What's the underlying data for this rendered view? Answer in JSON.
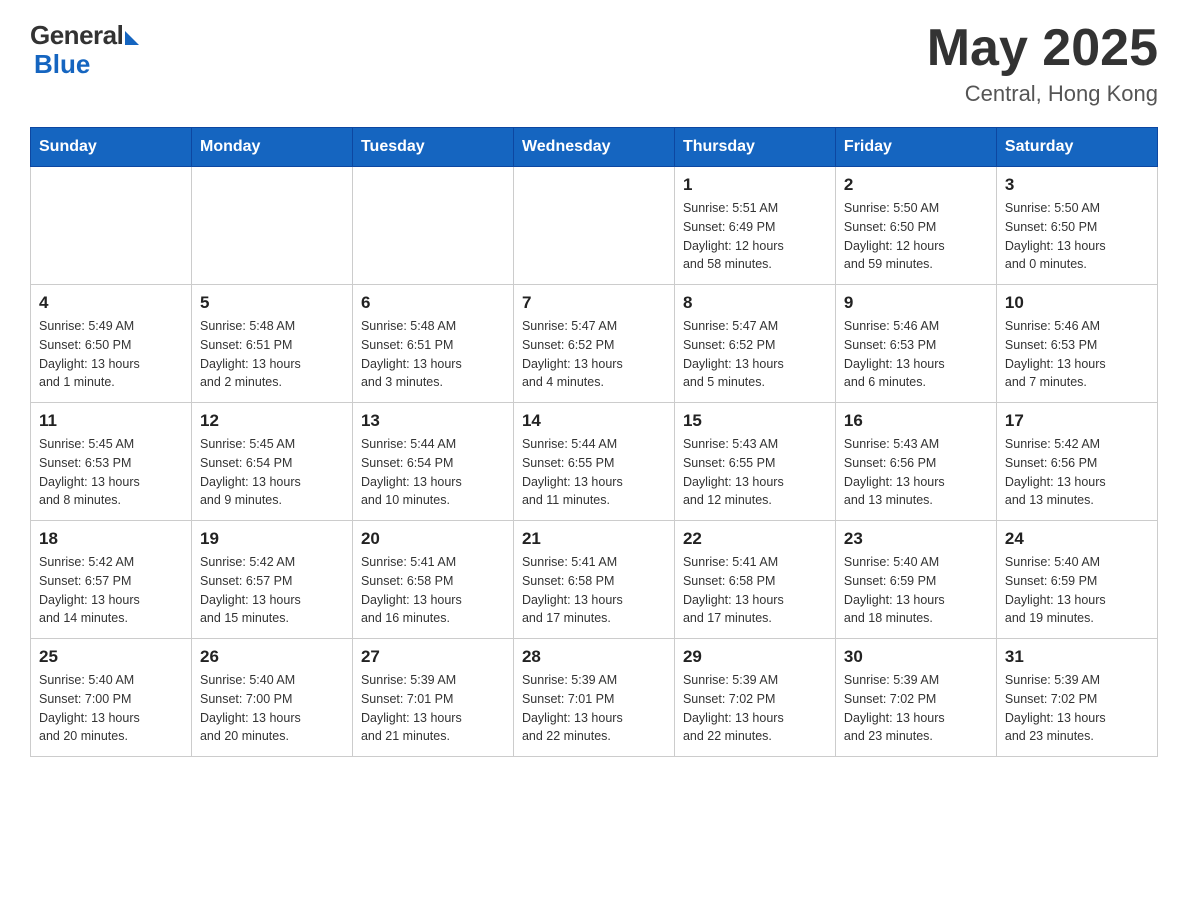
{
  "header": {
    "logo": {
      "general": "General",
      "blue": "Blue"
    },
    "month_year": "May 2025",
    "location": "Central, Hong Kong"
  },
  "days_of_week": [
    "Sunday",
    "Monday",
    "Tuesday",
    "Wednesday",
    "Thursday",
    "Friday",
    "Saturday"
  ],
  "weeks": [
    [
      {
        "day": "",
        "info": ""
      },
      {
        "day": "",
        "info": ""
      },
      {
        "day": "",
        "info": ""
      },
      {
        "day": "",
        "info": ""
      },
      {
        "day": "1",
        "info": "Sunrise: 5:51 AM\nSunset: 6:49 PM\nDaylight: 12 hours\nand 58 minutes."
      },
      {
        "day": "2",
        "info": "Sunrise: 5:50 AM\nSunset: 6:50 PM\nDaylight: 12 hours\nand 59 minutes."
      },
      {
        "day": "3",
        "info": "Sunrise: 5:50 AM\nSunset: 6:50 PM\nDaylight: 13 hours\nand 0 minutes."
      }
    ],
    [
      {
        "day": "4",
        "info": "Sunrise: 5:49 AM\nSunset: 6:50 PM\nDaylight: 13 hours\nand 1 minute."
      },
      {
        "day": "5",
        "info": "Sunrise: 5:48 AM\nSunset: 6:51 PM\nDaylight: 13 hours\nand 2 minutes."
      },
      {
        "day": "6",
        "info": "Sunrise: 5:48 AM\nSunset: 6:51 PM\nDaylight: 13 hours\nand 3 minutes."
      },
      {
        "day": "7",
        "info": "Sunrise: 5:47 AM\nSunset: 6:52 PM\nDaylight: 13 hours\nand 4 minutes."
      },
      {
        "day": "8",
        "info": "Sunrise: 5:47 AM\nSunset: 6:52 PM\nDaylight: 13 hours\nand 5 minutes."
      },
      {
        "day": "9",
        "info": "Sunrise: 5:46 AM\nSunset: 6:53 PM\nDaylight: 13 hours\nand 6 minutes."
      },
      {
        "day": "10",
        "info": "Sunrise: 5:46 AM\nSunset: 6:53 PM\nDaylight: 13 hours\nand 7 minutes."
      }
    ],
    [
      {
        "day": "11",
        "info": "Sunrise: 5:45 AM\nSunset: 6:53 PM\nDaylight: 13 hours\nand 8 minutes."
      },
      {
        "day": "12",
        "info": "Sunrise: 5:45 AM\nSunset: 6:54 PM\nDaylight: 13 hours\nand 9 minutes."
      },
      {
        "day": "13",
        "info": "Sunrise: 5:44 AM\nSunset: 6:54 PM\nDaylight: 13 hours\nand 10 minutes."
      },
      {
        "day": "14",
        "info": "Sunrise: 5:44 AM\nSunset: 6:55 PM\nDaylight: 13 hours\nand 11 minutes."
      },
      {
        "day": "15",
        "info": "Sunrise: 5:43 AM\nSunset: 6:55 PM\nDaylight: 13 hours\nand 12 minutes."
      },
      {
        "day": "16",
        "info": "Sunrise: 5:43 AM\nSunset: 6:56 PM\nDaylight: 13 hours\nand 13 minutes."
      },
      {
        "day": "17",
        "info": "Sunrise: 5:42 AM\nSunset: 6:56 PM\nDaylight: 13 hours\nand 13 minutes."
      }
    ],
    [
      {
        "day": "18",
        "info": "Sunrise: 5:42 AM\nSunset: 6:57 PM\nDaylight: 13 hours\nand 14 minutes."
      },
      {
        "day": "19",
        "info": "Sunrise: 5:42 AM\nSunset: 6:57 PM\nDaylight: 13 hours\nand 15 minutes."
      },
      {
        "day": "20",
        "info": "Sunrise: 5:41 AM\nSunset: 6:58 PM\nDaylight: 13 hours\nand 16 minutes."
      },
      {
        "day": "21",
        "info": "Sunrise: 5:41 AM\nSunset: 6:58 PM\nDaylight: 13 hours\nand 17 minutes."
      },
      {
        "day": "22",
        "info": "Sunrise: 5:41 AM\nSunset: 6:58 PM\nDaylight: 13 hours\nand 17 minutes."
      },
      {
        "day": "23",
        "info": "Sunrise: 5:40 AM\nSunset: 6:59 PM\nDaylight: 13 hours\nand 18 minutes."
      },
      {
        "day": "24",
        "info": "Sunrise: 5:40 AM\nSunset: 6:59 PM\nDaylight: 13 hours\nand 19 minutes."
      }
    ],
    [
      {
        "day": "25",
        "info": "Sunrise: 5:40 AM\nSunset: 7:00 PM\nDaylight: 13 hours\nand 20 minutes."
      },
      {
        "day": "26",
        "info": "Sunrise: 5:40 AM\nSunset: 7:00 PM\nDaylight: 13 hours\nand 20 minutes."
      },
      {
        "day": "27",
        "info": "Sunrise: 5:39 AM\nSunset: 7:01 PM\nDaylight: 13 hours\nand 21 minutes."
      },
      {
        "day": "28",
        "info": "Sunrise: 5:39 AM\nSunset: 7:01 PM\nDaylight: 13 hours\nand 22 minutes."
      },
      {
        "day": "29",
        "info": "Sunrise: 5:39 AM\nSunset: 7:02 PM\nDaylight: 13 hours\nand 22 minutes."
      },
      {
        "day": "30",
        "info": "Sunrise: 5:39 AM\nSunset: 7:02 PM\nDaylight: 13 hours\nand 23 minutes."
      },
      {
        "day": "31",
        "info": "Sunrise: 5:39 AM\nSunset: 7:02 PM\nDaylight: 13 hours\nand 23 minutes."
      }
    ]
  ]
}
